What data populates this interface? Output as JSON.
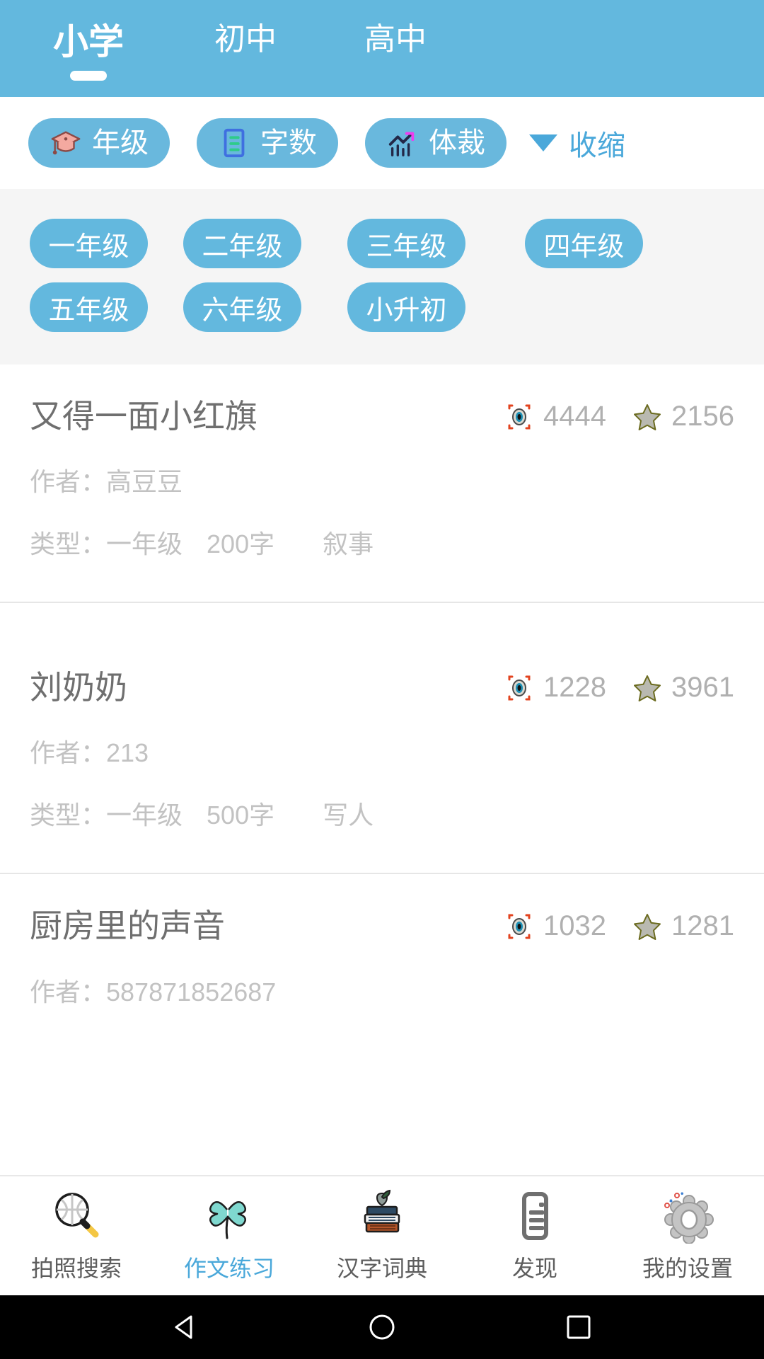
{
  "top_tabs": {
    "items": [
      {
        "label": "小学",
        "active": true
      },
      {
        "label": "初中",
        "active": false
      },
      {
        "label": "高中",
        "active": false
      }
    ]
  },
  "filters": {
    "chips": [
      {
        "label": "年级",
        "icon": "graduation-cap-icon"
      },
      {
        "label": "字数",
        "icon": "document-lines-icon"
      },
      {
        "label": "体裁",
        "icon": "trend-chart-icon"
      }
    ],
    "collapse": {
      "label": "收缩",
      "icon": "chevron-down-icon"
    }
  },
  "grades": {
    "row1": [
      "一年级",
      "二年级",
      "三年级",
      "四年级"
    ],
    "row2": [
      "五年级",
      "六年级",
      "小升初"
    ]
  },
  "articles": [
    {
      "title": "又得一面小红旗",
      "views": "4444",
      "favorites": "2156",
      "author_label": "作者：",
      "author": "高豆豆",
      "type_label": "类型：",
      "grade": "一年级",
      "words": "200字",
      "genre": "叙事"
    },
    {
      "title": "刘奶奶",
      "views": "1228",
      "favorites": "3961",
      "author_label": "作者：",
      "author": "213",
      "type_label": "类型：",
      "grade": "一年级",
      "words": "500字",
      "genre": "写人"
    },
    {
      "title": "厨房里的声音",
      "views": "1032",
      "favorites": "1281",
      "author_label": "作者：",
      "author": "587871852687",
      "type_label": "",
      "grade": "",
      "words": "",
      "genre": ""
    }
  ],
  "bottom_nav": {
    "items": [
      {
        "label": "拍照搜索",
        "icon": "camera-search-icon",
        "active": false
      },
      {
        "label": "作文练习",
        "icon": "clover-icon",
        "active": true
      },
      {
        "label": "汉字词典",
        "icon": "books-apple-icon",
        "active": false
      },
      {
        "label": "发现",
        "icon": "document-list-icon",
        "active": false
      },
      {
        "label": "我的设置",
        "icon": "gear-icon",
        "active": false
      }
    ]
  },
  "system_nav": {
    "back": "back-triangle-icon",
    "home": "home-circle-icon",
    "recents": "recents-square-icon"
  },
  "colors": {
    "brand_blue": "#63b8de",
    "accent_blue": "#4aa8da",
    "panel_gray": "#f5f5f5",
    "title_gray": "#6f6f6f",
    "meta_gray": "#c2c2c2"
  }
}
